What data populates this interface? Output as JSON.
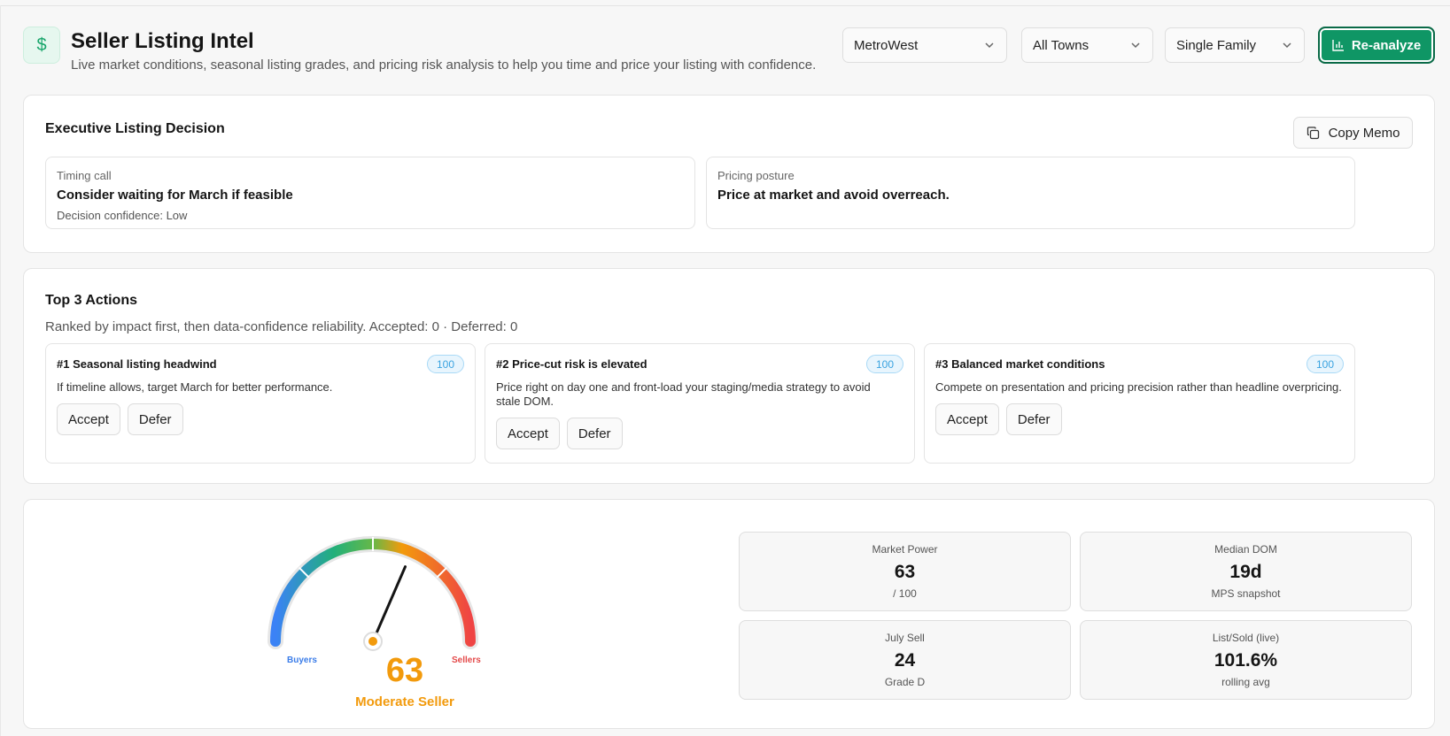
{
  "header": {
    "logo_glyph": "$",
    "title": "Seller Listing Intel",
    "subtitle": "Live market conditions, seasonal listing grades, and pricing risk analysis to help you time and price your listing with confidence.",
    "filters": {
      "region": "MetroWest",
      "town": "All Towns",
      "property_type": "Single Family"
    },
    "reanalyze_label": "Re-analyze"
  },
  "executive": {
    "title": "Executive Listing Decision",
    "copy_label": "Copy Memo",
    "timing": {
      "label": "Timing call",
      "value": "Consider waiting for March if feasible",
      "confidence": "Decision confidence: Low"
    },
    "pricing": {
      "label": "Pricing posture",
      "value": "Price at market and avoid overreach."
    }
  },
  "actions": {
    "title": "Top 3 Actions",
    "description": "Ranked by impact first, then data-confidence reliability. Accepted: 0 · Deferred: 0",
    "accept_label": "Accept",
    "defer_label": "Defer",
    "items": [
      {
        "title": "#1 Seasonal listing headwind",
        "score": "100",
        "body": "If timeline allows, target March for better performance."
      },
      {
        "title": "#2 Price-cut risk is elevated",
        "score": "100",
        "body": "Price right on day one and front-load your staging/media strategy to avoid stale DOM."
      },
      {
        "title": "#3 Balanced market conditions",
        "score": "100",
        "body": "Compete on presentation and pricing precision rather than headline overpricing."
      }
    ]
  },
  "gauge": {
    "value": "63",
    "fraction": 0.63,
    "label": "Moderate Seller",
    "left_label": "Buyers",
    "right_label": "Sellers",
    "colors": {
      "buyers": "#3b82f6",
      "neutral": "#22b07a",
      "moderate": "#f29a0c",
      "sellers": "#ef4444"
    }
  },
  "stats": [
    {
      "label": "Market Power",
      "value": "63",
      "sub": "/ 100"
    },
    {
      "label": "Median DOM",
      "value": "19d",
      "sub": "MPS snapshot"
    },
    {
      "label": "July Sell",
      "value": "24",
      "sub": "Grade D"
    },
    {
      "label": "List/Sold (live)",
      "value": "101.6%",
      "sub": "rolling avg"
    }
  ],
  "colors": {
    "accent": "#0f9665",
    "badge": "#3aa3e0"
  }
}
